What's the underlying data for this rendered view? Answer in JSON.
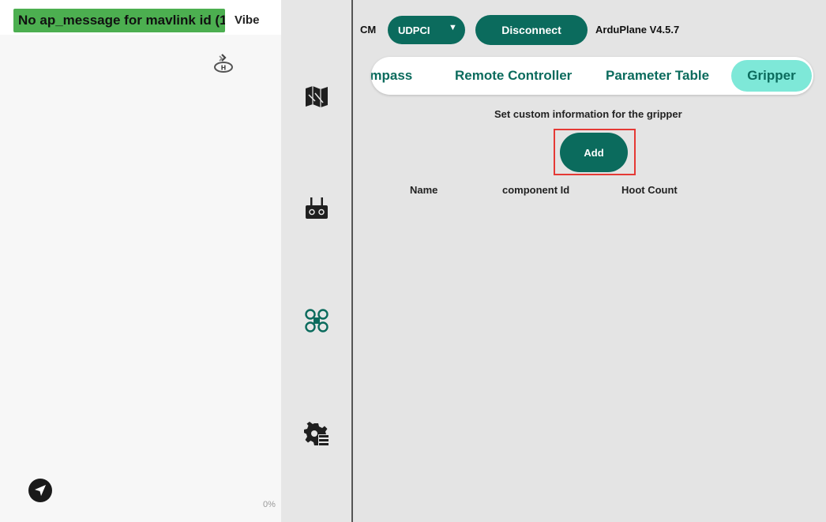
{
  "left_panel": {
    "message_banner": "No ap_message for mavlink id (1",
    "vibe_label": "Vibe",
    "percent_label": "0%"
  },
  "nav_rail": {
    "icons": [
      "map-icon",
      "remote-controller-icon",
      "drone-icon",
      "settings-list-icon"
    ]
  },
  "header": {
    "cm_label": "CM",
    "connection_type": "UDPCI",
    "disconnect_label": "Disconnect",
    "firmware": "ArduPlane V4.5.7"
  },
  "tabs": [
    {
      "label": "ompass",
      "active": false
    },
    {
      "label": "Remote Controller",
      "active": false
    },
    {
      "label": "Parameter Table",
      "active": false
    },
    {
      "label": "Gripper",
      "active": true
    }
  ],
  "gripper": {
    "info_text": "Set custom information for the gripper",
    "add_label": "Add",
    "columns": [
      "Name",
      "component Id",
      "Hoot Count"
    ]
  },
  "colors": {
    "accent": "#0b6b5d",
    "active_tab": "#7ee8d8",
    "banner": "#4caf50",
    "highlight": "#e53935"
  }
}
